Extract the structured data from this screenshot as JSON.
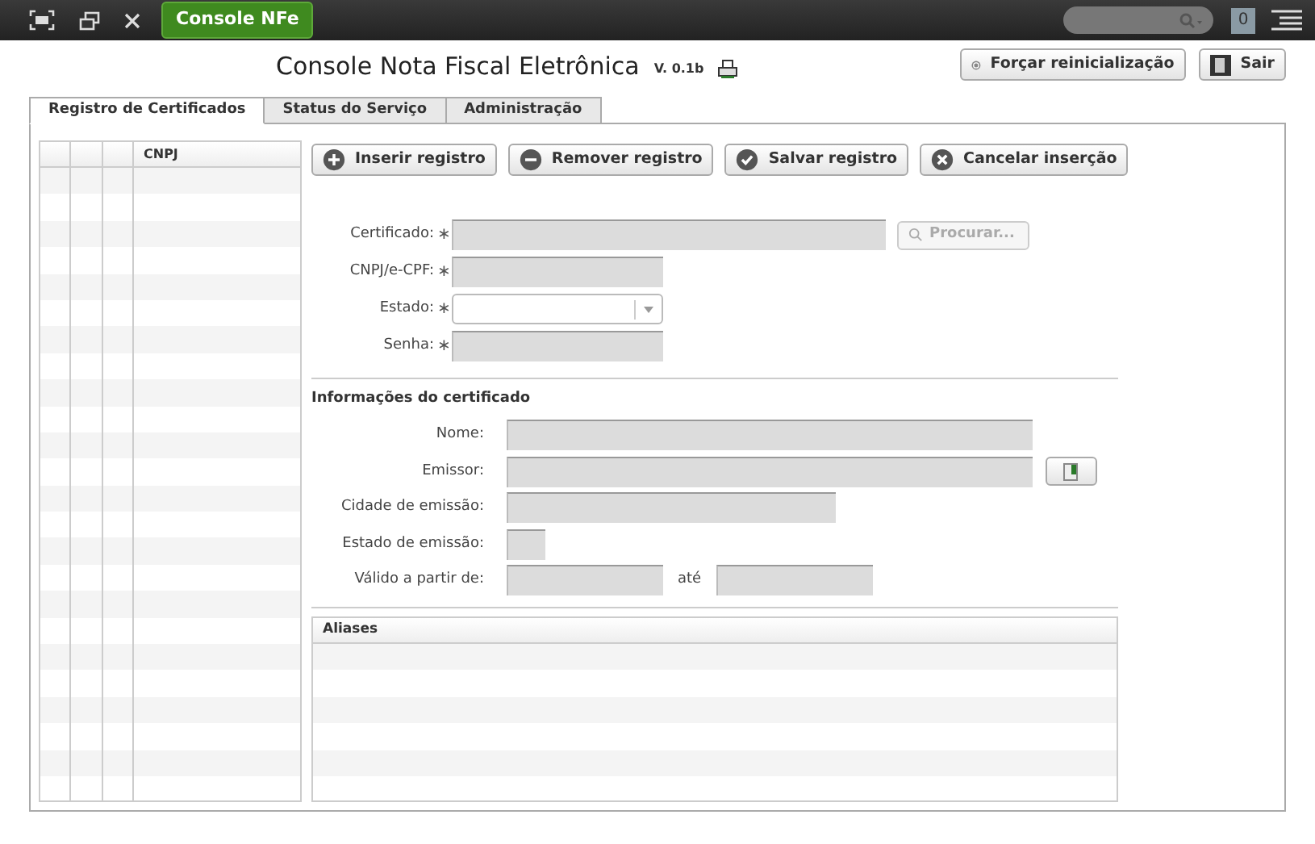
{
  "top_bar": {
    "app_button": "Console NFe",
    "notification_count": "0"
  },
  "header": {
    "title": "Console Nota Fiscal Eletrônica",
    "version": "V. 0.1b",
    "buttons": [
      {
        "kind": "restart",
        "label": "Forçar reinicialização"
      },
      {
        "kind": "exit",
        "label": "Sair"
      }
    ]
  },
  "tabs": [
    {
      "label": "Registro de Certificados",
      "selected": true
    },
    {
      "label": "Status do Serviço",
      "selected": false
    },
    {
      "label": "Administração",
      "selected": false
    }
  ],
  "table": {
    "columns": [
      "CNPJ"
    ]
  },
  "toolbar": [
    {
      "kind": "plus",
      "label": "Inserir registro"
    },
    {
      "kind": "minus",
      "label": "Remover registro"
    },
    {
      "kind": "check",
      "label": "Salvar registro"
    },
    {
      "kind": "cancel",
      "label": "Cancelar inserção"
    }
  ],
  "form": [
    {
      "kind": "file",
      "label": "Certificado:",
      "marker": "∗",
      "button": "Procurar..."
    },
    {
      "kind": "text",
      "label": "CNPJ/e-CPF:",
      "marker": "∗"
    },
    {
      "kind": "select",
      "label": "Estado:",
      "marker": "∗"
    },
    {
      "kind": "text",
      "label": "Senha:",
      "marker": "∗"
    }
  ],
  "certificate_info": {
    "title": "Informações do certificado",
    "fields": [
      {
        "kind": "wide",
        "label": "Nome:"
      },
      {
        "kind": "wide_button",
        "label": "Emissor:"
      },
      {
        "kind": "medium",
        "label": "Cidade de emissão:"
      },
      {
        "kind": "tiny",
        "label": "Estado de emissão:"
      },
      {
        "kind": "range",
        "label": "Válido a partir de:",
        "separator": "até"
      }
    ]
  },
  "aliases": {
    "title": "Aliases"
  }
}
